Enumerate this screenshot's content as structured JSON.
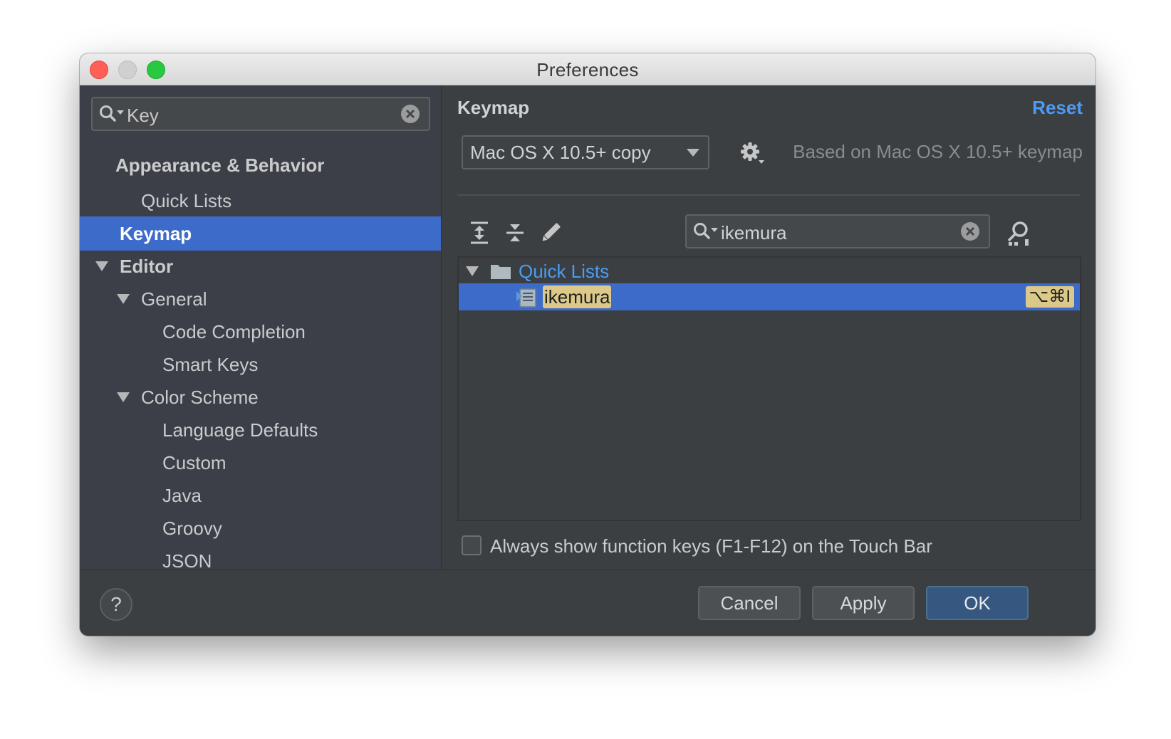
{
  "window": {
    "title": "Preferences"
  },
  "sidebar": {
    "search": {
      "value": "Key"
    },
    "items": [
      {
        "label": "Appearance & Behavior"
      },
      {
        "label": "Quick Lists"
      },
      {
        "label": "Keymap"
      },
      {
        "label": "Editor"
      },
      {
        "label": "General"
      },
      {
        "label": "Code Completion"
      },
      {
        "label": "Smart Keys"
      },
      {
        "label": "Color Scheme"
      },
      {
        "label": "Language Defaults"
      },
      {
        "label": "Custom"
      },
      {
        "label": "Java"
      },
      {
        "label": "Groovy"
      },
      {
        "label": "JSON"
      }
    ]
  },
  "main": {
    "title": "Keymap",
    "reset_label": "Reset",
    "keymap_select": {
      "value": "Mac OS X 10.5+ copy"
    },
    "based_on": "Based on Mac OS X 10.5+ keymap",
    "filter": {
      "value": "ikemura"
    },
    "tree": {
      "folder_label": "Quick Lists",
      "action_label": "ikemura",
      "shortcut": "⌥⌘I"
    },
    "touchbar_checkbox": {
      "label": "Always show function keys (F1-F12) on the Touch Bar",
      "checked": false
    }
  },
  "footer": {
    "cancel_label": "Cancel",
    "apply_label": "Apply",
    "ok_label": "OK",
    "help_label": "?"
  },
  "colors": {
    "accent": "#3d6bc9",
    "link": "#4a9cf6",
    "highlight": "#dcc98a",
    "close": "#ff5f57",
    "maximize": "#28c940"
  }
}
